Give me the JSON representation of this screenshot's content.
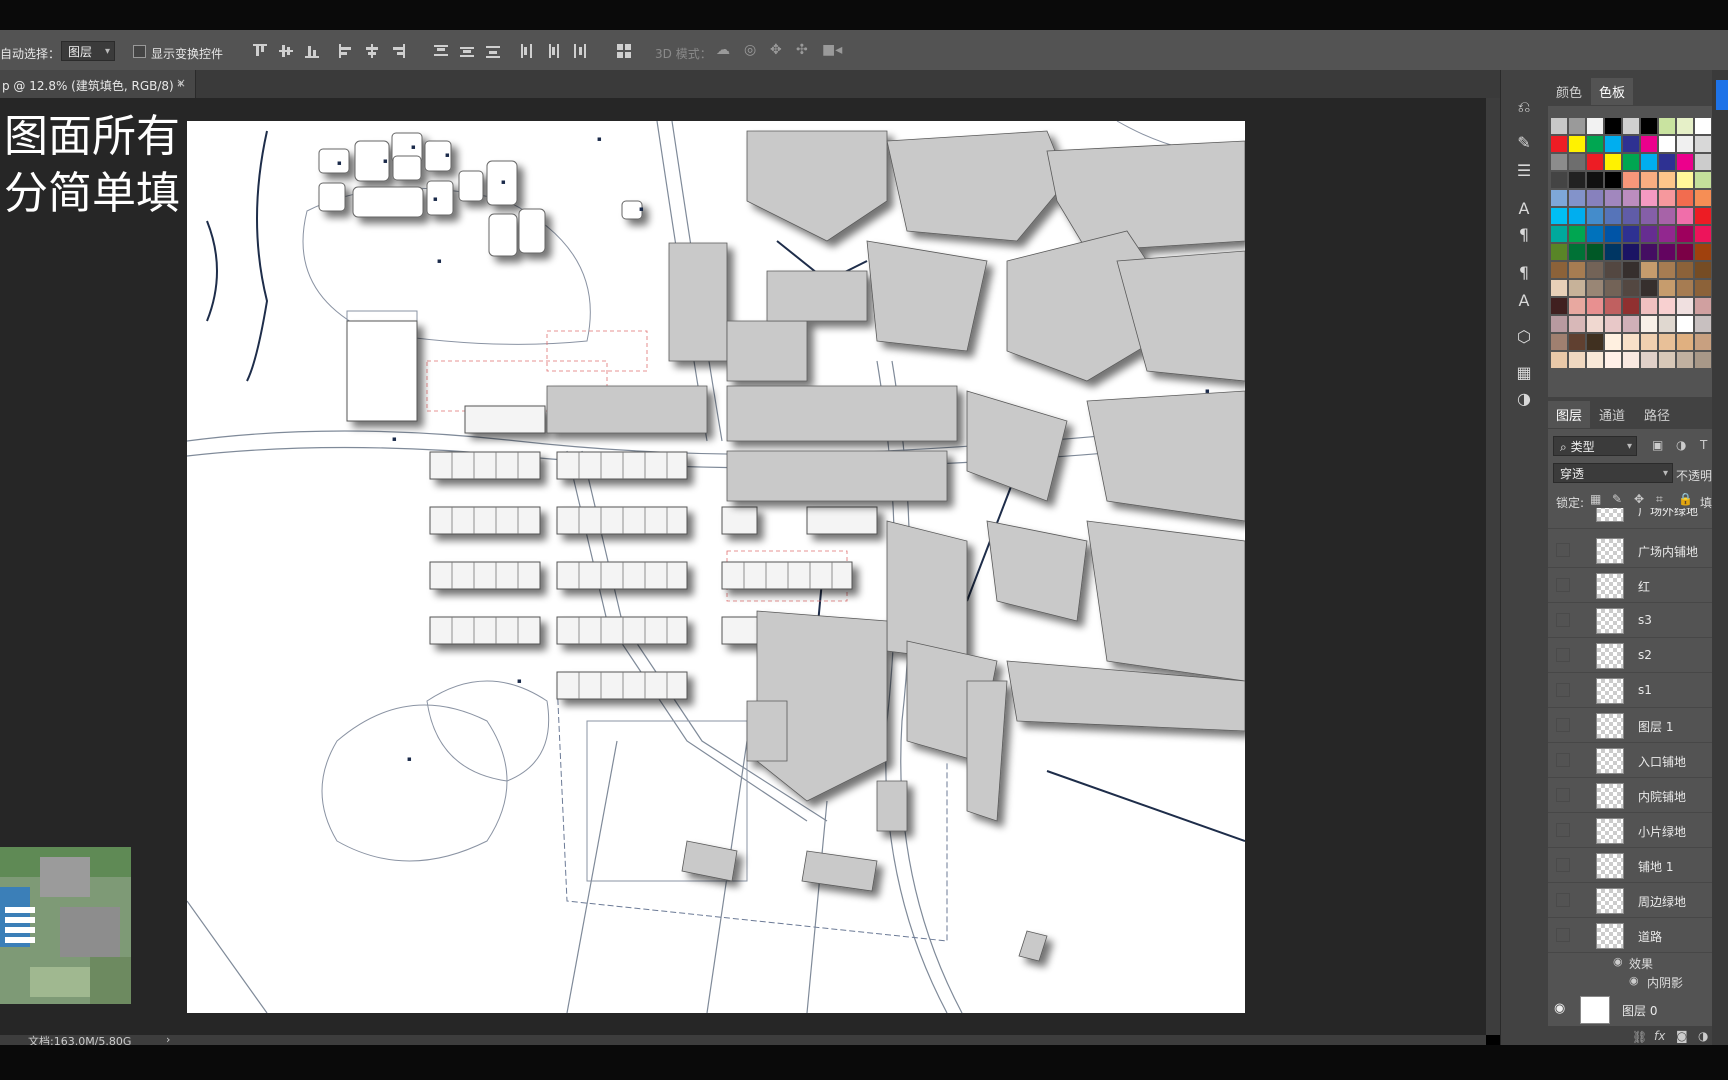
{
  "options_bar": {
    "auto_select_label": "自动选择：",
    "auto_select_value": "图层",
    "show_transform_label": "显示变换控件",
    "mode_3d_label": "3D 模式："
  },
  "document_tab": {
    "title": "p @ 12.8% (建筑填色, RGB/8) *",
    "close_glyph": "×"
  },
  "overlay_text": {
    "line1": "图面所有",
    "line2": "分简单填"
  },
  "status_bar": {
    "doc_info": "文档:163.0M/5.80G",
    "arrow": "›"
  },
  "panels": {
    "color_tab": "颜色",
    "swatches_tab": "色板",
    "layers_tab": "图层",
    "channels_tab": "通道",
    "paths_tab": "路径",
    "filter_kind": "类型",
    "blend_mode": "穿透",
    "opacity_label": "不透明",
    "lock_label": "锁定:",
    "fill_label": "填"
  },
  "swatch_colors": [
    [
      "#c8c8c8",
      "#9a9a9a",
      "#f2f2f2",
      "#000000",
      "#d0d0d0",
      "#000000",
      "#c9e3a0",
      "#e6f0c8",
      "#ffffff"
    ],
    [
      "#ee1c24",
      "#fff200",
      "#00a651",
      "#00aeef",
      "#2e3192",
      "#ec008c",
      "#ffffff",
      "#f0f0f0",
      "#d8d8d8"
    ],
    [
      "#8c8c8c",
      "#6e6e6e",
      "#ed1c24",
      "#fff200",
      "#00a651",
      "#00aeef",
      "#2e3192",
      "#ec008c",
      "#cccccc"
    ],
    [
      "#444444",
      "#222222",
      "#111111",
      "#000000",
      "#f7977a",
      "#f9ad81",
      "#fdc68a",
      "#fff79a",
      "#c4df9b"
    ],
    [
      "#7ea7d8",
      "#8393ca",
      "#8781bd",
      "#a187be",
      "#bc8dbf",
      "#f49ac2",
      "#f6989d",
      "#f26c4f",
      "#f68e55"
    ],
    [
      "#00bff3",
      "#00aeef",
      "#448ccb",
      "#5674b9",
      "#605ca8",
      "#855fa8",
      "#a763a8",
      "#f06eaa",
      "#ed1c24"
    ],
    [
      "#00a99d",
      "#00a651",
      "#0072bc",
      "#0054a6",
      "#2e3192",
      "#662d91",
      "#92278f",
      "#9e005d",
      "#ed145b"
    ],
    [
      "#598527",
      "#007236",
      "#005826",
      "#003663",
      "#1b1464",
      "#440e62",
      "#630460",
      "#7b0046",
      "#a0410d"
    ],
    [
      "#8c6239",
      "#a67c52",
      "#736357",
      "#534741",
      "#362f2d",
      "#c69c6d",
      "#a67c52",
      "#8c6239",
      "#754c24"
    ],
    [
      "#e8d0b8",
      "#c7b299",
      "#998675",
      "#736357",
      "#534741",
      "#362f2d",
      "#c69c6d",
      "#a67c52",
      "#8c6239"
    ],
    [
      "#402020",
      "#e8a8a0",
      "#e89090",
      "#c06060",
      "#903030",
      "#f0c0c0",
      "#f8d0d0",
      "#f0e0e0",
      "#d0a0a0"
    ],
    [
      "#b89aa0",
      "#d8b8b8",
      "#f0d8d0",
      "#e8c8c8",
      "#d0b0b8",
      "#f8f0e8",
      "#e0d8d0",
      "#ffffff",
      "#c8c0c0"
    ],
    [
      "#a08070",
      "#604030",
      "#403020",
      "#fff0e0",
      "#f8e0c8",
      "#f0d0b0",
      "#e8c098",
      "#e0b080",
      "#c8a080"
    ],
    [
      "#e8c8a8",
      "#f0d8c0",
      "#f8e8d8",
      "#fff0e8",
      "#f8e8e0",
      "#e0d0c8",
      "#d8c8b8",
      "#c0b0a0",
      "#a89888"
    ]
  ],
  "layers": [
    {
      "name": "广场内铺地",
      "visible": false
    },
    {
      "name": "红",
      "visible": false
    },
    {
      "name": "s3",
      "visible": false
    },
    {
      "name": "s2",
      "visible": false
    },
    {
      "name": "s1",
      "visible": false
    },
    {
      "name": "图层 1",
      "visible": false
    },
    {
      "name": "入口铺地",
      "visible": false
    },
    {
      "name": "内院铺地",
      "visible": false
    },
    {
      "name": "小片绿地",
      "visible": false
    },
    {
      "name": "铺地 1",
      "visible": false
    },
    {
      "name": "周边绿地",
      "visible": false
    },
    {
      "name": "道路",
      "visible": false
    }
  ],
  "layer_partial_top": "广场外绿地",
  "effects": {
    "label": "效果",
    "inner_shadow": "内阴影"
  },
  "bottom_layer": {
    "name": "图层 0"
  }
}
